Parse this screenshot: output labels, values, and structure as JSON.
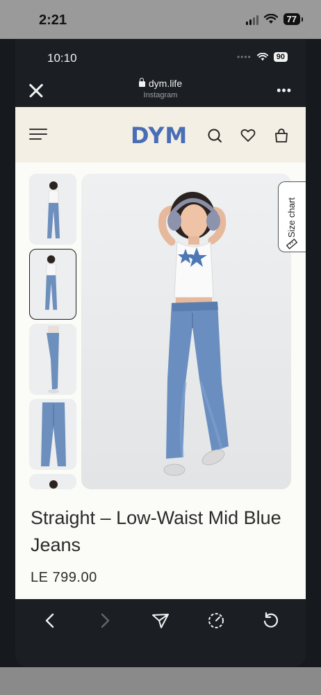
{
  "outer_status": {
    "time": "2:21",
    "battery": "77"
  },
  "inner_status": {
    "time": "10:10",
    "battery": "90"
  },
  "browser": {
    "domain": "dym.life",
    "source": "Instagram"
  },
  "site": {
    "logo": "DYM"
  },
  "product": {
    "title": "Straight – Low-Waist Mid Blue Jeans",
    "price": "LE 799.00",
    "size_chart_label": "Size chart",
    "thumbnail_count": 5,
    "active_thumbnail": 2
  },
  "icons": {
    "header": [
      "menu-icon",
      "search-icon",
      "heart-icon",
      "bag-icon"
    ],
    "toolbar": [
      "back-icon",
      "forward-icon",
      "share-icon",
      "speed-icon",
      "refresh-icon"
    ]
  },
  "colors": {
    "brand": "#4a6eb5",
    "header_bg": "#f3efe4",
    "page_bg": "#fbfbf8",
    "chrome_bg": "#1b1f23"
  }
}
